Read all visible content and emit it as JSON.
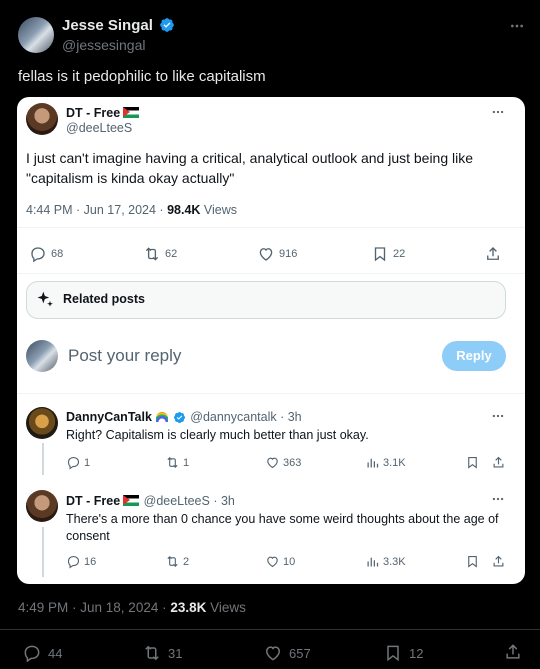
{
  "tweet": {
    "author_name": "Jesse Singal",
    "author_handle": "@jessesingal",
    "text": "fellas is it pedophilic to like capitalism",
    "time": "4:49 PM · Jun 18, 2024 · ",
    "views_count": "23.8K",
    "views_label": " Views",
    "replies": "44",
    "reposts": "31",
    "likes": "657",
    "bookmarks": "12"
  },
  "screenshot": {
    "quoted": {
      "author_name": "DT - Free",
      "author_handle": "@deeLteeS",
      "text": "I just can't imagine having a critical, analytical outlook and just being like \"capitalism is kinda okay actually\"",
      "time": "4:44 PM · Jun 17, 2024 · ",
      "views_count": "98.4K",
      "views_label": " Views",
      "replies": "68",
      "reposts": "62",
      "likes": "916",
      "bookmarks": "22"
    },
    "related_posts_label": "Related posts",
    "reply_placeholder": "Post your reply",
    "reply_button": "Reply",
    "replies": [
      {
        "author_name": "DannyCanTalk",
        "author_handle": "@dannycantalk · 3h",
        "text": "Right? Capitalism is clearly much better than just okay.",
        "replies": "1",
        "reposts": "1",
        "likes": "363",
        "views": "3.1K"
      },
      {
        "author_name": "DT - Free",
        "author_handle": "@deeLteeS · 3h",
        "text": "There's a more than 0 chance you have some weird thoughts about the age of consent",
        "replies": "16",
        "reposts": "2",
        "likes": "10",
        "views": "3.3K"
      }
    ]
  },
  "colors": {
    "background": "#000000",
    "card": "#ffffff",
    "accent": "#1d9bf0",
    "reply_button": "#8ecdf8",
    "secondary_text": "#71767b"
  }
}
